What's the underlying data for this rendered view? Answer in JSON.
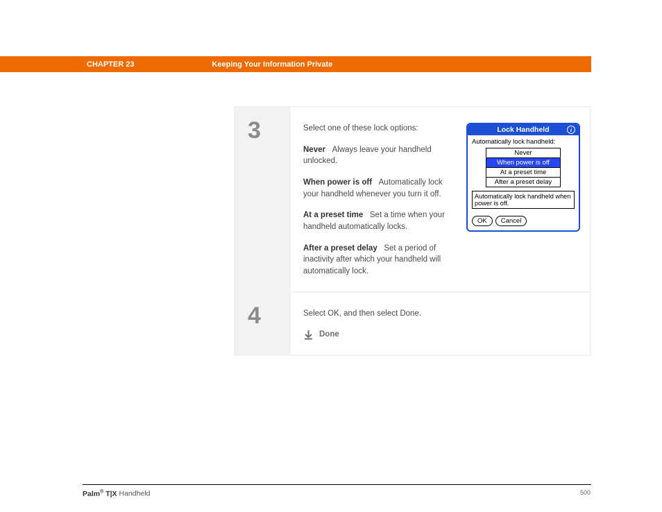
{
  "header": {
    "chapter": "CHAPTER 23",
    "title": "Keeping Your Information Private"
  },
  "steps": [
    {
      "number": "3",
      "intro": "Select one of these lock options:",
      "options": [
        {
          "label": "Never",
          "desc": "Always leave your handheld unlocked."
        },
        {
          "label": "When power is off",
          "desc": "Automatically lock your handheld whenever you turn it off."
        },
        {
          "label": "At a preset time",
          "desc": "Set a time when your handheld automatically locks."
        },
        {
          "label": "After a preset delay",
          "desc": "Set a period of inactivity after which your handheld will automatically lock."
        }
      ]
    },
    {
      "number": "4",
      "text": "Select OK, and then select Done.",
      "done": "Done"
    }
  ],
  "dialog": {
    "title": "Lock Handheld",
    "caption": "Automatically lock handheld:",
    "options": [
      "Never",
      "When power is off",
      "At a preset time",
      "After a preset delay"
    ],
    "selected_index": 1,
    "desc": "Automatically lock handheld when power is off.",
    "buttons": {
      "ok": "OK",
      "cancel": "Cancel"
    }
  },
  "footer": {
    "brand": "Palm",
    "model": "T|X",
    "product": "Handheld",
    "page": "500"
  }
}
